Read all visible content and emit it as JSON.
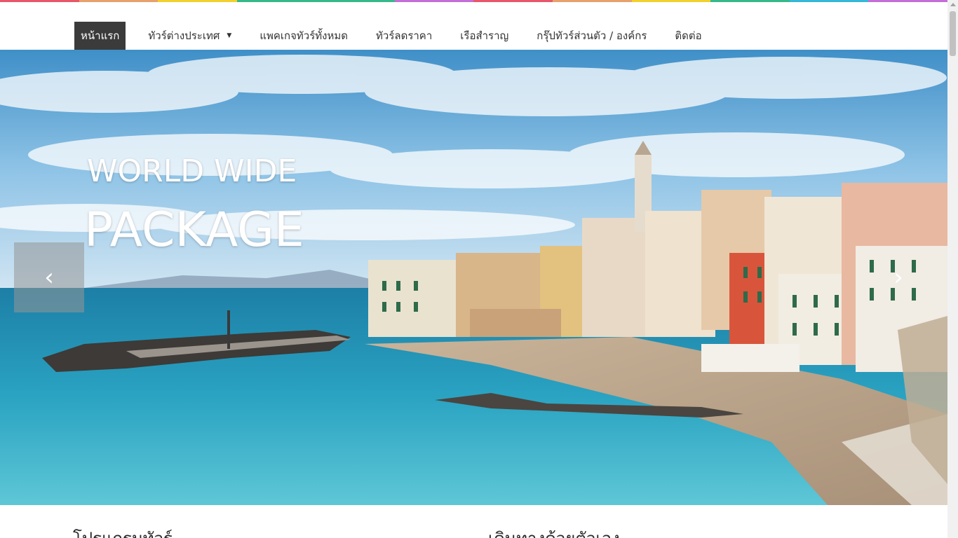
{
  "colors": {
    "top_stripe": [
      "#e8566a",
      "#e8a16c",
      "#f2d02e",
      "#38b88a",
      "#38b88a",
      "#c36fd6",
      "#e8566a",
      "#e8a16c",
      "#f2d02e",
      "#38b88a",
      "#36b8d6",
      "#c36fd6"
    ],
    "nav_active_bg": "#3b3b3b"
  },
  "nav": {
    "items": [
      {
        "label": "หน้าแรก",
        "active": true
      },
      {
        "label": "ทัวร์ต่างประเทศ",
        "has_dropdown": true
      },
      {
        "label": "แพคเกจทัวร์ทั้งหมด"
      },
      {
        "label": "ทัวร์ลดราคา"
      },
      {
        "label": "เรือสำราญ"
      },
      {
        "label": "กรุ๊ปทัวร์ส่วนตัว / องค์กร"
      },
      {
        "label": "ติดต่อ"
      }
    ],
    "caret": "▼"
  },
  "hero": {
    "title_line1": "WORLD WIDE",
    "title_line2": "PACKAGE",
    "prev_icon": "chevron-left-icon",
    "next_icon": "chevron-right-icon",
    "prev_glyph": "‹",
    "next_glyph": "›"
  },
  "sections": {
    "left_heading": "โปรแกรมทัวร์",
    "right_heading": "เดินทางด้วยตัวเอง"
  }
}
